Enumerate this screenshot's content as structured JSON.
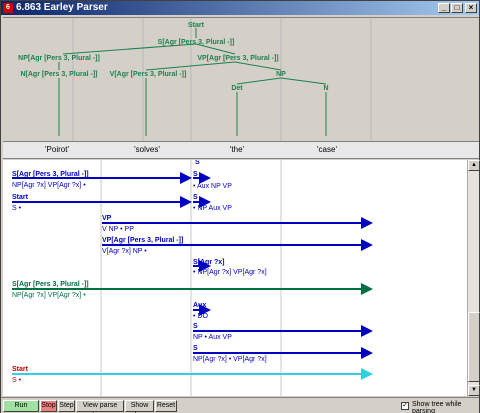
{
  "window": {
    "title": "6.863 Earley Parser",
    "icon": "app-icon-red",
    "min_label": "_",
    "max_label": "□",
    "close_label": "×"
  },
  "tree": {
    "nodes": [
      {
        "label": "Start"
      },
      {
        "label": "S[Agr [Pers 3, Plural -]]"
      },
      {
        "label": "NP[Agr [Pers 3, Plural -]]"
      },
      {
        "label": "VP[Agr [Pers 3, Plural -]]"
      },
      {
        "label": "N[Agr [Pers 3, Plural -]]"
      },
      {
        "label": "V[Agr [Pers 3, Plural -]]"
      },
      {
        "label": "NP"
      },
      {
        "label": "Det"
      },
      {
        "label": "N"
      }
    ]
  },
  "words": [
    "'Poirot'",
    "'solves'",
    "'the'",
    "'case'"
  ],
  "chart": {
    "edges": [
      {
        "top": "S[Agr [Pers 3, Plural -]]",
        "bottom": "NP[Agr ?x] VP[Agr ?x] •"
      },
      {
        "top": "S",
        "bottom": "• Aux NP VP"
      },
      {
        "top": "Start",
        "bottom": "S •"
      },
      {
        "top": "S",
        "bottom": "• NP Aux VP"
      },
      {
        "top": "VP",
        "bottom": "V NP • PP"
      },
      {
        "top": "VP[Agr [Pers 3, Plural -]]",
        "bottom": "V[Agr ?x] NP •"
      },
      {
        "top": "S[Agr ?x]",
        "bottom": "• NP[Agr ?x] VP[Agr ?x]"
      },
      {
        "top": "S[Agr [Pers 3, Plural -]]",
        "bottom": "NP[Agr ?x] VP[Agr ?x] •"
      },
      {
        "top": "Aux",
        "bottom": "• DO"
      },
      {
        "top": "S",
        "bottom": "NP • Aux VP"
      },
      {
        "top": "S",
        "bottom": "NP[Agr ?x] • VP[Agr ?x]"
      },
      {
        "top": "Start",
        "bottom": "S •"
      }
    ],
    "partial_top_label": "S"
  },
  "toolbar": {
    "run": "Run parser",
    "stop": "Stop",
    "step": "Step",
    "view": "View parse trees",
    "log": "Show log",
    "reset": "Reset",
    "show_tree_label": "Show tree while parsing",
    "show_tree_checked": "✓"
  },
  "colors": {
    "edge_blue": "#0000c0",
    "edge_green": "#007040",
    "edge_cyan": "#30d0e0",
    "tree_green": "#1a8050",
    "start_red": "#c00000",
    "run_bg": "#a0e0a0",
    "stop_bg": "#f08080"
  }
}
